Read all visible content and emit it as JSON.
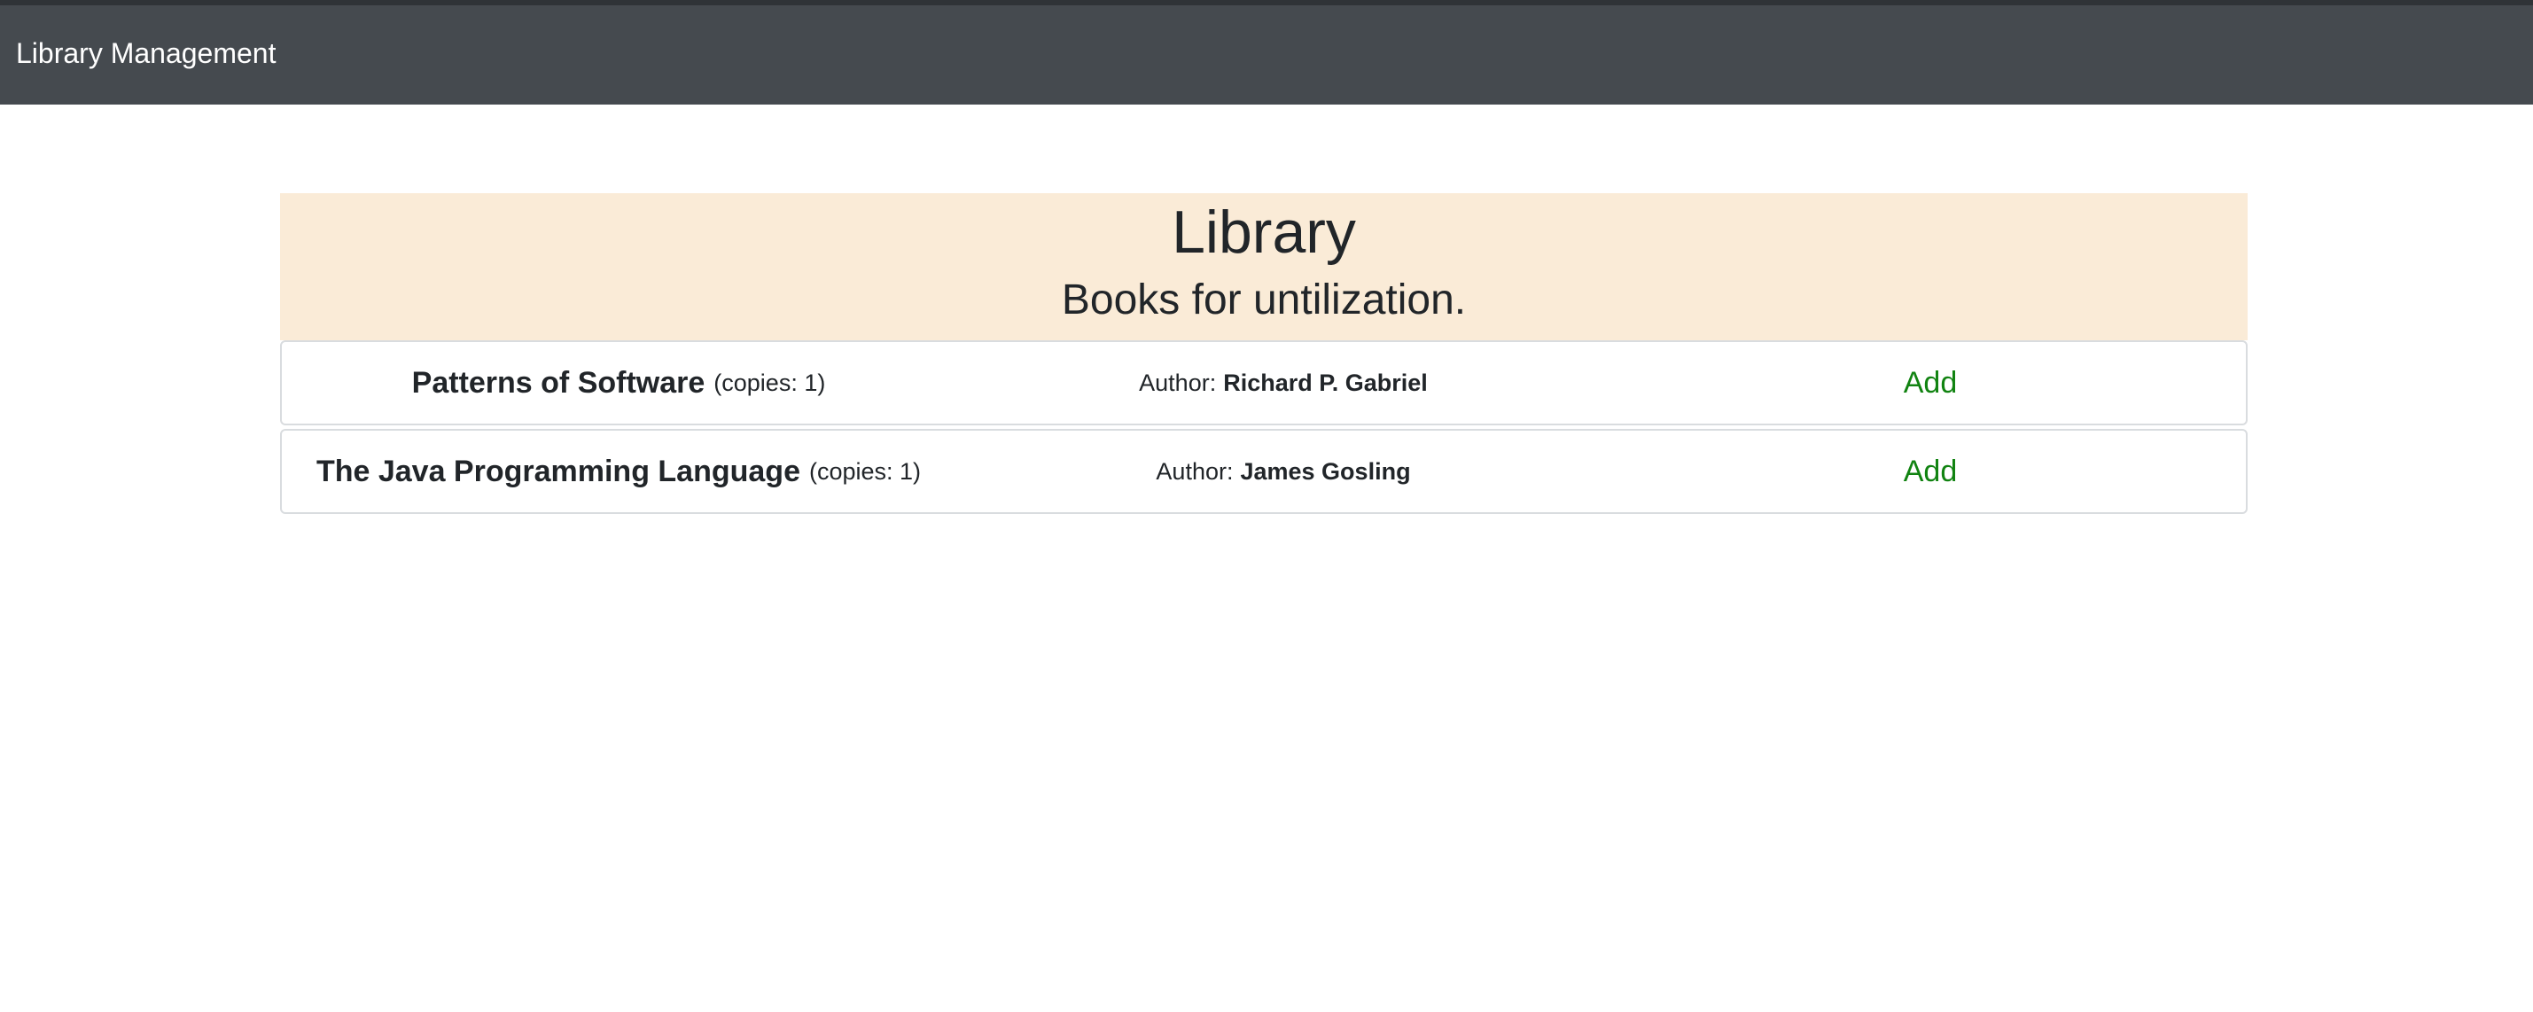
{
  "navbar": {
    "brand": "Library Management"
  },
  "library": {
    "title": "Library",
    "subtitle": "Books for untilization.",
    "author_label": "Author:",
    "books": [
      {
        "title": "Patterns of Software",
        "copies": "(copies: 1)",
        "author": "Richard P. Gabriel",
        "action": "Add"
      },
      {
        "title": "The Java Programming Language",
        "copies": "(copies: 1)",
        "author": "James Gosling",
        "action": "Add"
      }
    ]
  },
  "colors": {
    "navbar_bg": "#454a4f",
    "header_bg": "#faebd7",
    "action_green": "#118311"
  }
}
